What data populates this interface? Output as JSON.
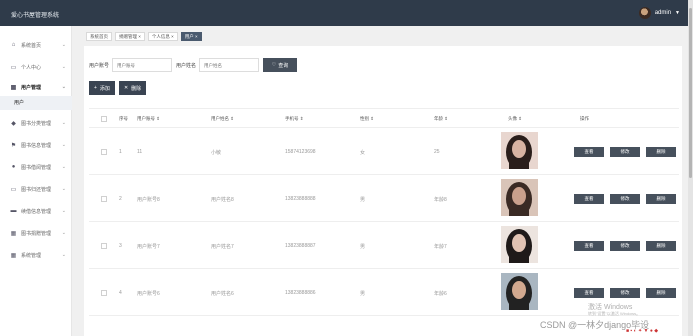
{
  "header": {
    "title": "爱心书屋管理系统",
    "user": "admin"
  },
  "sidebar": {
    "items": [
      {
        "label": "系统首页",
        "icon": "home-icon",
        "glyph": "⌂"
      },
      {
        "label": "个人中心",
        "icon": "doc-icon",
        "glyph": "▭"
      },
      {
        "label": "用户管理",
        "icon": "grid-icon",
        "glyph": "▦"
      },
      {
        "label": "图书分类管理",
        "icon": "bulb-icon",
        "glyph": "◆"
      },
      {
        "label": "图书信息管理",
        "icon": "flag-icon",
        "glyph": "⚑"
      },
      {
        "label": "图书借阅管理",
        "icon": "user-icon",
        "glyph": "●"
      },
      {
        "label": "图书归还管理",
        "icon": "doc-icon",
        "glyph": "▭"
      },
      {
        "label": "续借信息管理",
        "icon": "card-icon",
        "glyph": "▬"
      },
      {
        "label": "图书捐赠管理",
        "icon": "grid-icon",
        "glyph": "▦"
      },
      {
        "label": "系统管理",
        "icon": "grid-icon",
        "glyph": "▦"
      }
    ],
    "sub_item": "用户"
  },
  "tabs": [
    {
      "label": "系统首页"
    },
    {
      "label": "捐赠管理 ×"
    },
    {
      "label": "个人信息 ×"
    },
    {
      "label": "用户 ×"
    }
  ],
  "search": {
    "account_label": "用户账号",
    "account_placeholder": "用户账号",
    "name_label": "用户姓名",
    "name_placeholder": "用户姓名",
    "button": "查询"
  },
  "actions": {
    "add": "添加",
    "delete": "删除"
  },
  "table": {
    "headers": [
      "",
      "序号",
      "用户账号 ⇕",
      "用户姓名 ⇕",
      "手机号 ⇕",
      "性别 ⇕",
      "年龄 ⇕",
      "头像 ⇕",
      "操作"
    ],
    "rows": [
      {
        "index": "1",
        "account": "11",
        "name": "小敏",
        "phone": "15874123698",
        "gender": "女",
        "age": "25",
        "photo_colors": [
          "#e8d6cf",
          "#2a1e1b",
          "#d8b3a2"
        ]
      },
      {
        "index": "2",
        "account": "用户账号8",
        "name": "用户姓名8",
        "phone": "13823888888",
        "gender": "男",
        "age": "年龄8",
        "photo_colors": [
          "#d9c4b8",
          "#3a2a24",
          "#caa08c"
        ]
      },
      {
        "index": "3",
        "account": "用户账号7",
        "name": "用户姓名7",
        "phone": "13823888887",
        "gender": "男",
        "age": "年龄7",
        "photo_colors": [
          "#ece4df",
          "#1f1a19",
          "#e1c3b3"
        ]
      },
      {
        "index": "4",
        "account": "用户账号6",
        "name": "用户姓名6",
        "phone": "13823888886",
        "gender": "男",
        "age": "年龄6",
        "photo_colors": [
          "#a9b6c1",
          "#222",
          "#d2a98f"
        ]
      }
    ],
    "ops": [
      "查看",
      "修改",
      "删除"
    ]
  },
  "watermarks": {
    "windows_line1": "激活 Windows",
    "windows_line2": "转到\"设置\"以激活 Windows。",
    "csdn": "CSDN @一林夕django毕设"
  }
}
